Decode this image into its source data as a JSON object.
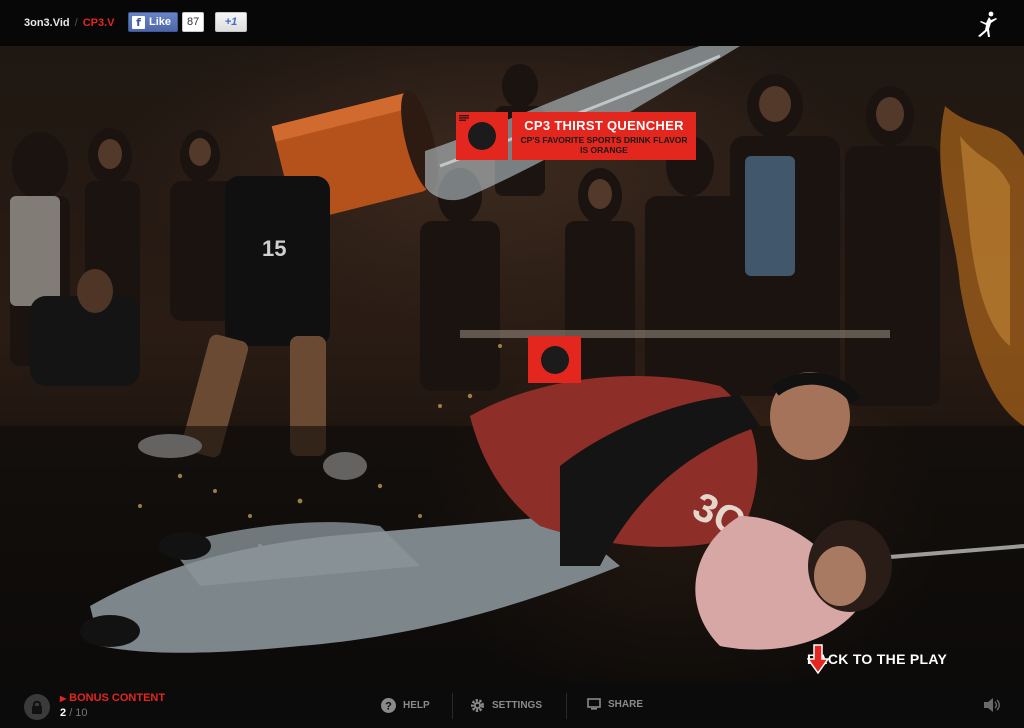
{
  "header": {
    "site": "3on3.Vid",
    "separator": "/",
    "current": "CP3.V",
    "fb_like_label": "Like",
    "fb_like_count": "87",
    "gplus_label": "+1"
  },
  "hotspot": {
    "title": "CP3 THIRST QUENCHER",
    "description": "CP'S FAVORITE SPORTS DRINK FLAVOR IS ORANGE"
  },
  "back_to_play": "BACK TO THE PLAY",
  "footer": {
    "bonus_title": "BONUS CONTENT",
    "page_current": "2",
    "page_total": "/ 10",
    "help": "HELP",
    "settings": "SETTINGS",
    "share": "SHARE"
  },
  "colors": {
    "accent": "#e3261e",
    "background": "#070707"
  },
  "icons": [
    "facebook-f-icon",
    "jumpman-logo",
    "chat-icon",
    "sneaker-icon",
    "down-arrow-icon",
    "lock-icon",
    "help-icon",
    "gear-icon",
    "share-icon",
    "volume-icon"
  ]
}
